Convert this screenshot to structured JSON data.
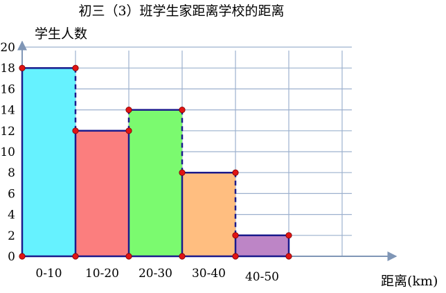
{
  "chart_data": {
    "type": "bar",
    "title": "初三（3）班学生家距离学校的距离",
    "ylabel": "学生人数",
    "xlabel": "距离(km)",
    "categories": [
      "0-10",
      "10-20",
      "20-30",
      "30-40",
      "40-50"
    ],
    "values": [
      18,
      12,
      14,
      8,
      2
    ],
    "ylim": [
      0,
      20
    ],
    "yticks": [
      "0",
      "2",
      "4",
      "6",
      "8",
      "10",
      "12",
      "14",
      "16",
      "18",
      "20"
    ],
    "grid": true,
    "colors": [
      "#66f2ff",
      "#fb7e7e",
      "#7bfa6f",
      "#ffbe80",
      "#bd85c6"
    ],
    "edge_color": "#1a1a8c",
    "marker_color": "#e01414",
    "axis_color": "#7f96b6",
    "grid_color": "#9cb0ce"
  }
}
